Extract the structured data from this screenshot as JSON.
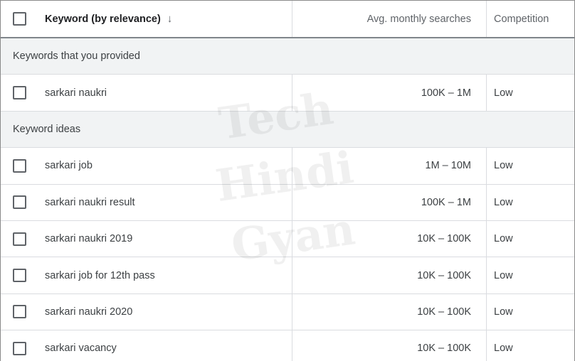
{
  "header": {
    "keyword": "Keyword (by relevance)",
    "sort_icon": "arrow-down-icon",
    "searches": "Avg. monthly searches",
    "competition": "Competition"
  },
  "groups": [
    {
      "label": "Keywords that you provided",
      "rows": [
        {
          "keyword": "sarkari naukri",
          "searches": "100K – 1M",
          "competition": "Low"
        }
      ]
    },
    {
      "label": "Keyword ideas",
      "rows": [
        {
          "keyword": "sarkari job",
          "searches": "1M – 10M",
          "competition": "Low"
        },
        {
          "keyword": "sarkari naukri result",
          "searches": "100K – 1M",
          "competition": "Low"
        },
        {
          "keyword": "sarkari naukri 2019",
          "searches": "10K – 100K",
          "competition": "Low"
        },
        {
          "keyword": "sarkari job for 12th pass",
          "searches": "10K – 100K",
          "competition": "Low"
        },
        {
          "keyword": "sarkari naukri 2020",
          "searches": "10K – 100K",
          "competition": "Low"
        },
        {
          "keyword": "sarkari vacancy",
          "searches": "10K – 100K",
          "competition": "Low"
        }
      ]
    }
  ],
  "watermark": [
    "Tech",
    "Hindi",
    "Gyan"
  ]
}
